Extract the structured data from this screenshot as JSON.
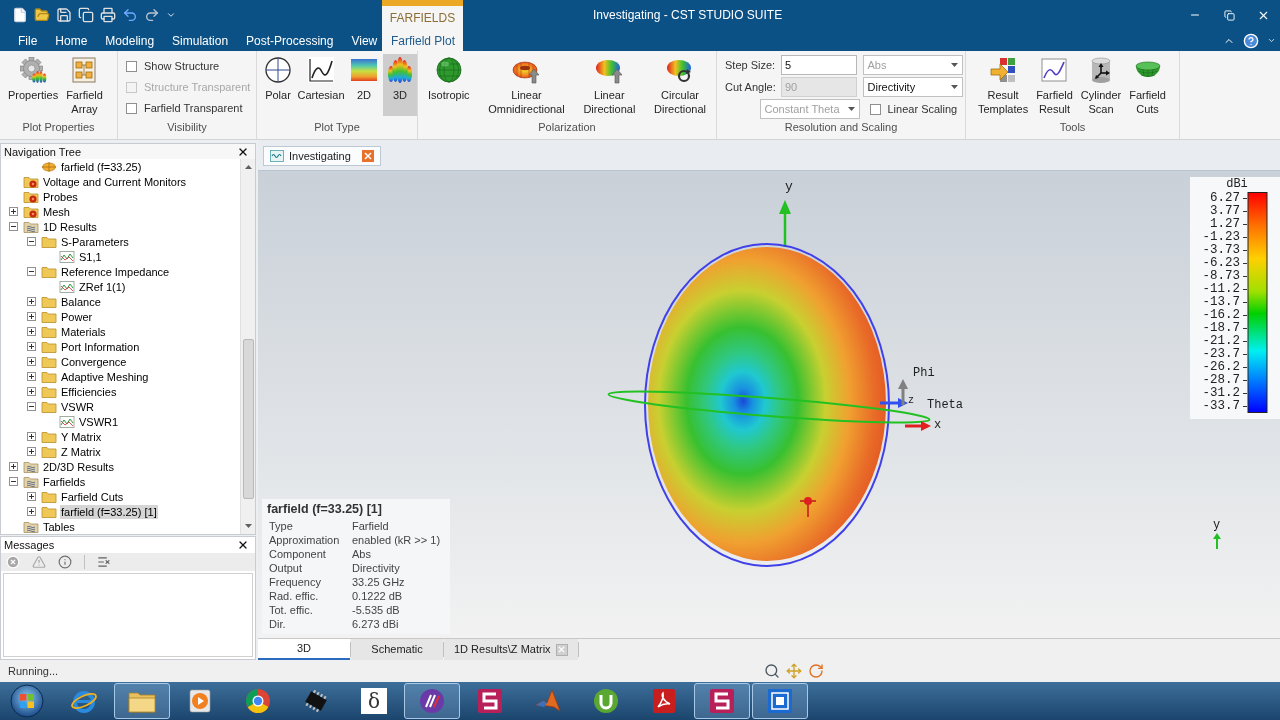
{
  "window": {
    "title": "Investigating - CST STUDIO SUITE"
  },
  "ribbon": {
    "context_label": "FARFIELDS",
    "tabs": [
      {
        "label": "File",
        "kind": "standard",
        "selected": false
      },
      {
        "label": "Home",
        "kind": "standard",
        "selected": false
      },
      {
        "label": "Modeling",
        "kind": "standard",
        "selected": false
      },
      {
        "label": "Simulation",
        "kind": "standard",
        "selected": false
      },
      {
        "label": "Post-Processing",
        "kind": "standard",
        "selected": false
      },
      {
        "label": "View",
        "kind": "standard",
        "selected": false
      },
      {
        "label": "Farfield Plot",
        "kind": "contextual",
        "selected": true
      }
    ],
    "groups": [
      {
        "label": "Plot Properties",
        "kind": "buttons",
        "items": [
          {
            "label": "Properties"
          },
          {
            "label": "Farfield Array"
          }
        ]
      },
      {
        "label": "Visibility",
        "kind": "checks",
        "items": [
          {
            "label": "Show Structure",
            "checked": false,
            "disabled": false
          },
          {
            "label": "Structure Transparent",
            "checked": false,
            "disabled": true
          },
          {
            "label": "Farfield Transparent",
            "checked": false,
            "disabled": false
          }
        ]
      },
      {
        "label": "Plot Type",
        "kind": "buttons",
        "items": [
          {
            "label": "Polar",
            "selected": false
          },
          {
            "label": "Cartesian",
            "selected": false
          },
          {
            "label": "2D",
            "selected": false
          },
          {
            "label": "3D",
            "selected": true
          }
        ]
      },
      {
        "label": "Polarization",
        "kind": "buttons",
        "items": [
          {
            "label": "Isotropic"
          },
          {
            "label": "Linear Omnidirectional"
          },
          {
            "label": "Linear Directional"
          },
          {
            "label": "Circular Directional"
          }
        ]
      },
      {
        "label": "Resolution and Scaling",
        "kind": "form",
        "items": [
          {
            "kind": "field",
            "label": "Step Size:",
            "value": "5",
            "disabled": false
          },
          {
            "kind": "dropdown",
            "value": "Abs",
            "disabled": true
          },
          {
            "kind": "field",
            "label": "Cut Angle:",
            "value": "90",
            "disabled": true
          },
          {
            "kind": "dropdown",
            "value": "Directivity",
            "disabled": false
          },
          {
            "kind": "dropdown",
            "value": "Constant Theta",
            "disabled": true
          },
          {
            "kind": "checkbox",
            "label": "Linear Scaling",
            "checked": false
          }
        ]
      },
      {
        "label": "Tools",
        "kind": "buttons",
        "items": [
          {
            "label": "Result Templates"
          },
          {
            "label": "Farfield Result"
          },
          {
            "label": "Cylinder Scan"
          },
          {
            "label": "Farfield Cuts"
          }
        ]
      }
    ]
  },
  "navigation_tree": {
    "title": "Navigation Tree",
    "nodes": [
      {
        "children": [
          {
            "label": "farfield (f=33.25)",
            "kind": "farfield",
            "selected": false
          }
        ]
      },
      {
        "label": "Voltage and Current Monitors",
        "kind": "monitor-folder",
        "selected": false
      },
      {
        "label": "Probes",
        "kind": "monitor-folder",
        "selected": false
      },
      {
        "label": "Mesh",
        "kind": "monitor-folder",
        "selected": false,
        "expanded": false
      },
      {
        "label": "1D Results",
        "kind": "results",
        "selected": false,
        "expanded": true,
        "children": [
          {
            "label": "S-Parameters",
            "kind": "folder",
            "selected": false,
            "expanded": true,
            "children": [
              {
                "label": "S1,1",
                "kind": "curve",
                "selected": false
              }
            ]
          },
          {
            "label": "Reference Impedance",
            "kind": "folder",
            "selected": false,
            "expanded": true,
            "children": [
              {
                "label": "ZRef 1(1)",
                "kind": "curve",
                "selected": false
              }
            ]
          },
          {
            "label": "Balance",
            "kind": "folder",
            "selected": false,
            "expanded": false
          },
          {
            "label": "Power",
            "kind": "folder",
            "selected": false,
            "expanded": false
          },
          {
            "label": "Materials",
            "kind": "folder",
            "selected": false,
            "expanded": false
          },
          {
            "label": "Port Information",
            "kind": "folder",
            "selected": false,
            "expanded": false
          },
          {
            "label": "Convergence",
            "kind": "folder",
            "selected": false,
            "expanded": false
          },
          {
            "label": "Adaptive Meshing",
            "kind": "folder",
            "selected": false,
            "expanded": false
          },
          {
            "label": "Efficiencies",
            "kind": "folder",
            "selected": false,
            "expanded": false
          },
          {
            "label": "VSWR",
            "kind": "folder",
            "selected": false,
            "expanded": true,
            "children": [
              {
                "label": "VSWR1",
                "kind": "curve",
                "selected": false
              }
            ]
          },
          {
            "label": "Y Matrix",
            "kind": "folder",
            "selected": false,
            "expanded": false
          },
          {
            "label": "Z Matrix",
            "kind": "folder",
            "selected": false,
            "expanded": false
          }
        ]
      },
      {
        "label": "2D/3D Results",
        "kind": "results",
        "selected": false,
        "expanded": false
      },
      {
        "label": "Farfields",
        "kind": "results",
        "selected": false,
        "expanded": true,
        "children": [
          {
            "label": "Farfield Cuts",
            "kind": "folder",
            "selected": false,
            "expanded": false
          },
          {
            "label": "farfield (f=33.25) [1]",
            "kind": "folder",
            "selected": true,
            "expanded": false
          }
        ]
      },
      {
        "label": "Tables",
        "kind": "results",
        "selected": false
      }
    ]
  },
  "messages": {
    "title": "Messages"
  },
  "document_tabs": [
    {
      "label": "Investigating",
      "selected": true
    }
  ],
  "viewport": {
    "axis_labels": {
      "y": "y",
      "phi": "Phi",
      "z": "z",
      "theta": "Theta",
      "x": "x"
    },
    "corner_axis_label": "y",
    "color_scale": {
      "title": "dBi",
      "labels": [
        "6.27",
        "3.77",
        "1.27",
        "-1.23",
        "-3.73",
        "-6.23",
        "-8.73",
        "-11.2",
        "-13.7",
        "-16.2",
        "-18.7",
        "-21.2",
        "-23.7",
        "-26.2",
        "-28.7",
        "-31.2",
        "-33.7"
      ]
    },
    "info": {
      "title": "farfield (f=33.25) [1]",
      "rows": [
        {
          "label": "Type",
          "value": "Farfield"
        },
        {
          "label": "Approximation",
          "value": "enabled (kR >> 1)"
        },
        {
          "label": "Component",
          "value": "Abs"
        },
        {
          "label": "Output",
          "value": "Directivity"
        },
        {
          "label": "Frequency",
          "value": "33.25 GHz"
        },
        {
          "label": "Rad. effic.",
          "value": "0.1222 dB"
        },
        {
          "label": "Tot. effic.",
          "value": "-5.535 dB"
        },
        {
          "label": "Dir.",
          "value": "6.273 dBi"
        }
      ]
    }
  },
  "view_tabs": [
    {
      "label": "3D",
      "selected": true,
      "closable": false
    },
    {
      "label": "Schematic",
      "selected": false,
      "closable": false
    },
    {
      "label": "1D Results\\Z Matrix",
      "selected": false,
      "closable": true
    }
  ],
  "status_bar": {
    "text": "Running..."
  },
  "taskbar": {
    "items": [
      {
        "running": false
      },
      {
        "running": true
      },
      {
        "running": false
      },
      {
        "running": false
      },
      {
        "running": false
      },
      {
        "label": "δ",
        "running": false
      },
      {
        "running": true
      },
      {
        "running": false
      },
      {
        "running": false
      },
      {
        "running": false
      },
      {
        "running": false
      },
      {
        "running": true
      },
      {
        "running": true
      }
    ]
  }
}
